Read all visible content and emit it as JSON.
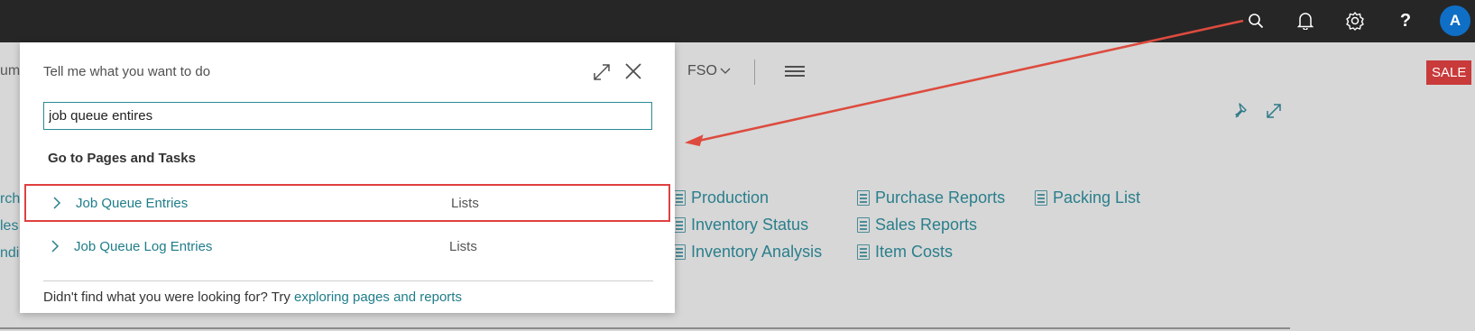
{
  "topbar": {
    "icons": [
      "search-icon",
      "bell-icon",
      "gear-icon",
      "help-icon"
    ],
    "help_glyph": "?",
    "avatar_initial": "A",
    "avatar_color": "#0f6fc6"
  },
  "background": {
    "left_fragments": [
      "um",
      "rch",
      "les",
      "ndi"
    ],
    "nav_fso": "FSO",
    "sale_badge": "SALE",
    "links": [
      {
        "label": "Production"
      },
      {
        "label": "Inventory Status"
      },
      {
        "label": "Inventory Analysis"
      },
      {
        "label": "Purchase Reports"
      },
      {
        "label": "Sales Reports"
      },
      {
        "label": "Item Costs"
      },
      {
        "label": "Packing List"
      }
    ]
  },
  "dialog": {
    "title": "Tell me what you want to do",
    "search_value": "job queue entires",
    "section_title": "Go to Pages and Tasks",
    "results": [
      {
        "label": "Job Queue Entries",
        "type": "Lists",
        "selected": true
      },
      {
        "label": "Job Queue Log Entries",
        "type": "Lists",
        "selected": false
      }
    ],
    "footer_text": "Didn't find what you were looking for? Try ",
    "footer_link": "exploring pages and reports"
  },
  "colors": {
    "accent": "#1f7d8a",
    "highlight": "#e04040",
    "topbar": "#262626",
    "sale": "#c93a3a"
  }
}
